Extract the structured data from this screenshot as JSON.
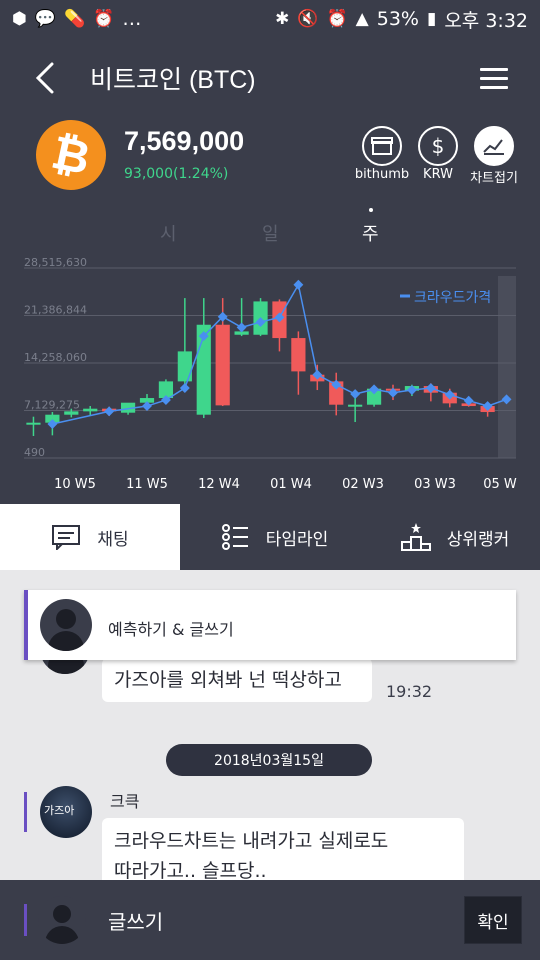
{
  "status_bar": {
    "left_icons": [
      "app-icon",
      "kakaotalk-icon",
      "pill-icon",
      "alarm-icon"
    ],
    "more": "…",
    "right_icons": [
      "bluetooth-icon",
      "mute-icon",
      "alarm-icon",
      "lte-signal-icon"
    ],
    "battery": "53%",
    "time": "오후 3:32"
  },
  "header": {
    "title": "비트코인 (BTC)"
  },
  "coin": {
    "symbol": "₿",
    "price": "7,569,000",
    "change": "93,000(1.24%)",
    "change_color": "#3fd68c"
  },
  "actions": [
    {
      "label": "bithumb",
      "icon": "store-icon"
    },
    {
      "label": "KRW",
      "icon": "dollar-icon"
    },
    {
      "label": "차트접기",
      "icon": "chart-icon"
    }
  ],
  "periods": [
    {
      "label": "시",
      "active": false
    },
    {
      "label": "일",
      "active": false
    },
    {
      "label": "주",
      "active": true
    }
  ],
  "chart_data": {
    "type": "candlestick",
    "y_ticks": [
      "28,515,630",
      "21,386,844",
      "14,258,060",
      "7,129,275",
      "490"
    ],
    "ylim": [
      490,
      28515630
    ],
    "x_ticks": [
      "10 W5",
      "11 W5",
      "12 W4",
      "01 W4",
      "02 W3",
      "03 W3",
      "05 W"
    ],
    "legend": "크라우드가격",
    "legend_position": "top-right",
    "grid": true,
    "up_color": "#3fd68c",
    "down_color": "#f05a5a",
    "line_color": "#4a8ff0",
    "candles": [
      {
        "o": 5200000,
        "h": 6200000,
        "l": 3300000,
        "c": 5300000
      },
      {
        "o": 5300000,
        "h": 6900000,
        "l": 3400000,
        "c": 6500000
      },
      {
        "o": 6500000,
        "h": 7400000,
        "l": 6100000,
        "c": 7000000
      },
      {
        "o": 7000000,
        "h": 7800000,
        "l": 6300000,
        "c": 7400000
      },
      {
        "o": 7400000,
        "h": 7700000,
        "l": 6300000,
        "c": 7000000
      },
      {
        "o": 6800000,
        "h": 8200000,
        "l": 6500000,
        "c": 8300000
      },
      {
        "o": 8300000,
        "h": 9600000,
        "l": 8000000,
        "c": 9000000
      },
      {
        "o": 9000000,
        "h": 11800000,
        "l": 8700000,
        "c": 11500000
      },
      {
        "o": 11500000,
        "h": 24000000,
        "l": 11000000,
        "c": 16000000
      },
      {
        "o": 6500000,
        "h": 24000000,
        "l": 6000000,
        "c": 20000000
      },
      {
        "o": 20000000,
        "h": 24000000,
        "l": 7800000,
        "c": 7900000
      },
      {
        "o": 18500000,
        "h": 24000000,
        "l": 18300000,
        "c": 19000000
      },
      {
        "o": 18500000,
        "h": 24000000,
        "l": 18300000,
        "c": 23500000
      },
      {
        "o": 23500000,
        "h": 23800000,
        "l": 16000000,
        "c": 18000000
      },
      {
        "o": 18000000,
        "h": 19000000,
        "l": 9500000,
        "c": 13000000
      },
      {
        "o": 12500000,
        "h": 14000000,
        "l": 10200000,
        "c": 11500000
      },
      {
        "o": 11500000,
        "h": 12800000,
        "l": 6400000,
        "c": 8000000
      },
      {
        "o": 8000000,
        "h": 9500000,
        "l": 5400000,
        "c": 8000000
      },
      {
        "o": 8000000,
        "h": 10500000,
        "l": 7700000,
        "c": 10400000
      },
      {
        "o": 10400000,
        "h": 11000000,
        "l": 8700000,
        "c": 10100000
      },
      {
        "o": 10100000,
        "h": 11000000,
        "l": 9300000,
        "c": 10800000
      },
      {
        "o": 10800000,
        "h": 11200000,
        "l": 8500000,
        "c": 9800000
      },
      {
        "o": 9800000,
        "h": 10400000,
        "l": 7600000,
        "c": 8200000
      },
      {
        "o": 8200000,
        "h": 8800000,
        "l": 7700000,
        "c": 7800000
      },
      {
        "o": 7800000,
        "h": 7900000,
        "l": 6200000,
        "c": 6900000
      },
      {
        "o": 0,
        "h": 0,
        "l": 0,
        "c": 0
      }
    ],
    "crowd_price": [
      null,
      5100000,
      null,
      null,
      7000000,
      null,
      7800000,
      8700000,
      10500000,
      18300000,
      21200000,
      19600000,
      20400000,
      21100000,
      26000000,
      12500000,
      11000000,
      9600000,
      10300000,
      9800000,
      10200000,
      10500000,
      9500000,
      8600000,
      7800000,
      8800000
    ]
  },
  "tabs": [
    {
      "label": "채팅",
      "icon": "chat-icon",
      "active": true
    },
    {
      "label": "타임라인",
      "icon": "list-icon",
      "active": false
    },
    {
      "label": "상위랭커",
      "icon": "podium-icon",
      "active": false
    }
  ],
  "predict": {
    "label": "예측하기 & 글쓰기"
  },
  "messages": [
    {
      "text": "가즈아를 외쳐봐 넌 떡상하고",
      "time": "19:32"
    }
  ],
  "date_divider": "2018년03월15일",
  "second_message": {
    "user": "크큭",
    "avatar_text": "가즈아",
    "lines": [
      "크라우드차트는 내려가고 실제로도",
      "따라가고.. 슬프당.."
    ]
  },
  "composer": {
    "label": "글쓰기",
    "confirm": "확인"
  }
}
